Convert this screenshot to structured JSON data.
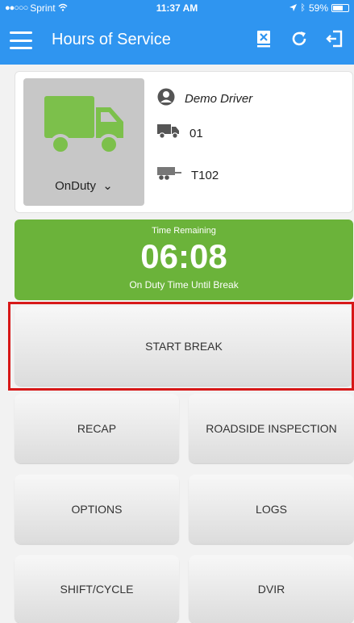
{
  "status_bar": {
    "carrier": "Sprint",
    "time": "11:37 AM",
    "battery": "59%"
  },
  "nav": {
    "title": "Hours of Service",
    "icons": [
      "menu-icon",
      "close-box-icon",
      "refresh-icon",
      "logout-icon"
    ]
  },
  "driver_card": {
    "duty_status": "OnDuty",
    "driver_name": "Demo Driver",
    "truck": "01",
    "trailer": "T102"
  },
  "timer": {
    "label": "Time Remaining",
    "value": "06:08",
    "subtitle": "On Duty Time Until Break"
  },
  "buttons": {
    "start_break": "START BREAK",
    "recap": "RECAP",
    "roadside": "ROADSIDE INSPECTION",
    "options": "OPTIONS",
    "logs": "LOGS",
    "shift_cycle": "SHIFT/CYCLE",
    "dvir": "DVIR"
  },
  "colors": {
    "header": "#2f95f0",
    "timer": "#6bb33a",
    "truck": "#7cc04b",
    "highlight": "#d71818"
  }
}
